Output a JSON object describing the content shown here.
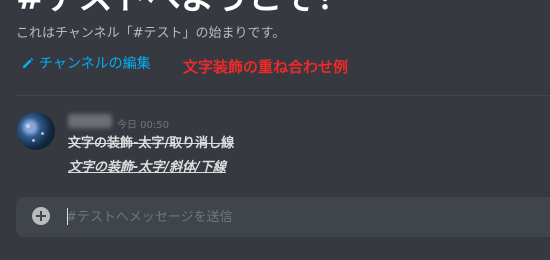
{
  "welcome": {
    "title": "#テストへようこそ！",
    "subtitle": "これはチャンネル「#テスト」の始まりです。",
    "edit_channel_label": "チャンネルの編集"
  },
  "annotation": "文字装飾の重ね合わせ例",
  "message": {
    "timestamp": "今日 00:50",
    "lines": [
      "文字の装飾-太字/取り消し線",
      "文字の装飾-太字/斜体/下線"
    ]
  },
  "composer": {
    "placeholder": "#テストへメッセージを送信"
  },
  "colors": {
    "background": "#36393f",
    "link": "#00b0f4",
    "annotation": "#ed2a2a"
  },
  "icons": [
    "pencil-icon",
    "add-circle-icon"
  ]
}
